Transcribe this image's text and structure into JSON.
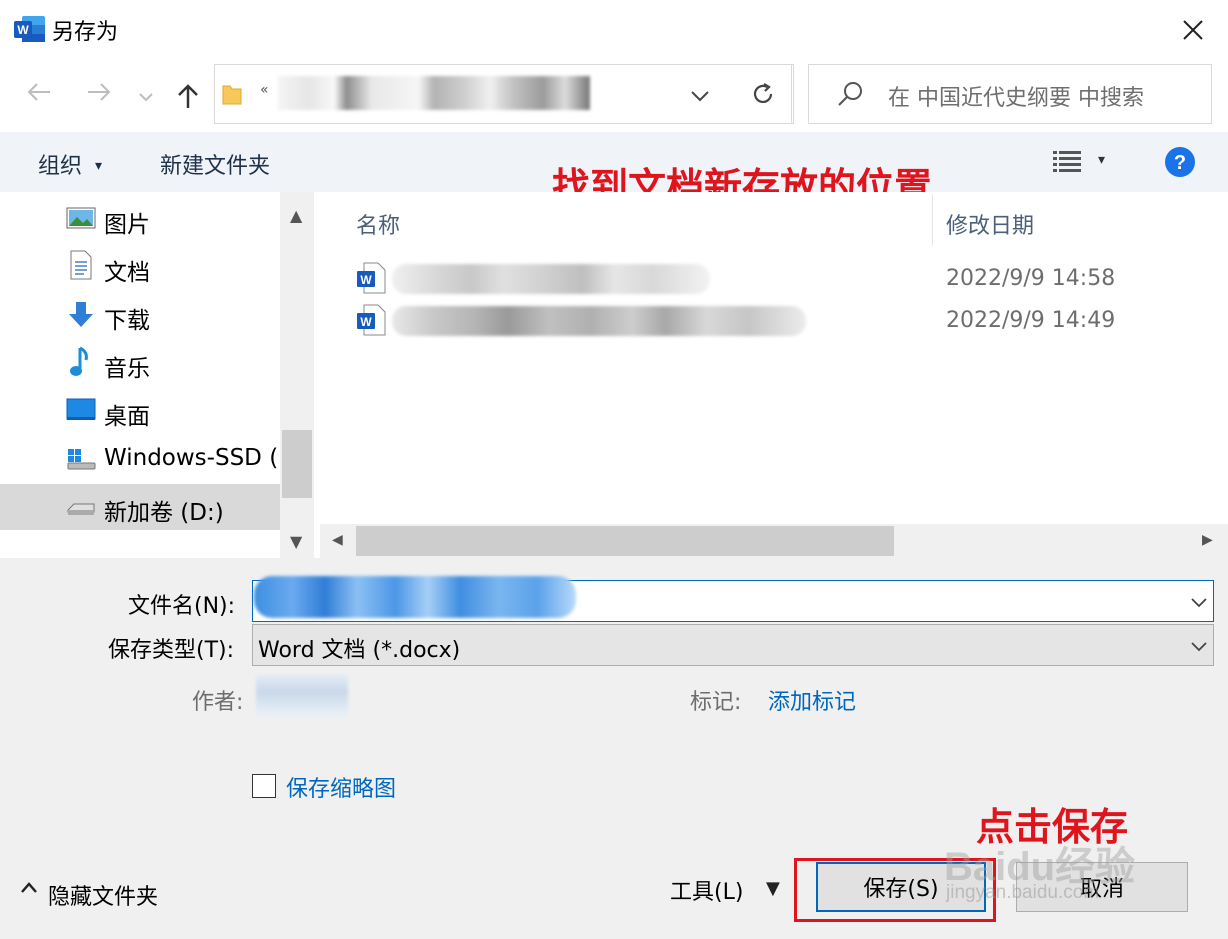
{
  "window": {
    "title": "另存为",
    "app_icon": "word-icon"
  },
  "nav": {
    "address_prefix": "«",
    "search_placeholder": "在 中国近代史纲要 中搜索"
  },
  "toolbar": {
    "organize_label": "组织",
    "new_folder_label": "新建文件夹"
  },
  "sidebar": {
    "items": [
      {
        "label": "图片",
        "icon": "pictures-icon"
      },
      {
        "label": "文档",
        "icon": "documents-icon"
      },
      {
        "label": "下载",
        "icon": "downloads-icon"
      },
      {
        "label": "音乐",
        "icon": "music-icon"
      },
      {
        "label": "桌面",
        "icon": "desktop-icon"
      },
      {
        "label": "Windows-SSD (",
        "icon": "drive-c-icon"
      },
      {
        "label": "新加卷 (D:)",
        "icon": "drive-d-icon",
        "selected": true
      }
    ]
  },
  "filelist": {
    "columns": [
      "名称",
      "修改日期"
    ],
    "files": [
      {
        "date": "2022/9/9 14:58"
      },
      {
        "date": "2022/9/9 14:49"
      }
    ]
  },
  "form": {
    "filename_label": "文件名(N):",
    "filetype_label": "保存类型(T):",
    "filetype_value": "Word 文档 (*.docx)",
    "author_label": "作者:",
    "tags_label": "标记:",
    "tags_link": "添加标记",
    "thumbnail_label": "保存缩略图"
  },
  "footer": {
    "hide_folders_label": "隐藏文件夹",
    "tools_label": "工具(L)",
    "save_label": "保存(S)",
    "cancel_label": "取消"
  },
  "annotations": {
    "location_note": "找到文档新存放的位置",
    "save_note": "点击保存"
  },
  "watermark": {
    "text": "Baidu经验",
    "url": "jingyan.baidu.com"
  },
  "colors": {
    "toolbar_bg": "#f0f4f9",
    "accent": "#0067c0",
    "annotation_red": "#e0141c",
    "word_blue": "#185abd"
  }
}
